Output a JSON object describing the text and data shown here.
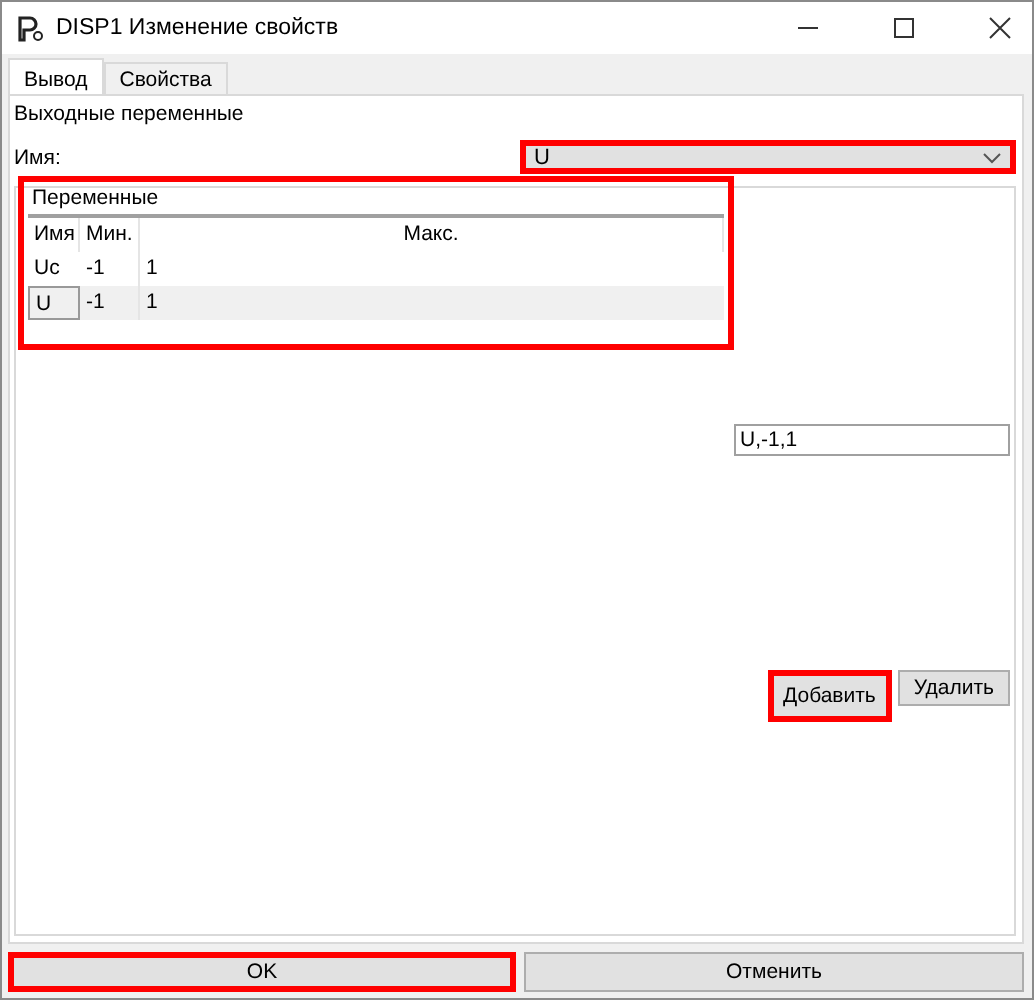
{
  "window": {
    "title": "DISP1 Изменение свойств"
  },
  "tabs": [
    {
      "label": "Вывод",
      "selected": true
    },
    {
      "label": "Свойства",
      "selected": false
    }
  ],
  "section_label": "Выходные переменные",
  "name_field": {
    "label": "Имя:",
    "value": "U",
    "highlighted": true
  },
  "variables": {
    "title": "Переменные",
    "highlighted": true,
    "columns": [
      "Имя",
      "Мин.",
      "Макс."
    ],
    "rows": [
      {
        "cells": [
          "Uc",
          "-1",
          "1"
        ],
        "selected": false
      },
      {
        "cells": [
          "U",
          "-1",
          "1"
        ],
        "selected": true
      }
    ]
  },
  "entry_field": {
    "value": "U,-1,1"
  },
  "buttons": [
    {
      "label": "Добавить",
      "highlighted": true
    },
    {
      "label": "Удалить",
      "highlighted": false
    }
  ],
  "footer_buttons": [
    {
      "label": "OK",
      "highlighted": true
    },
    {
      "label": "Отменить",
      "highlighted": false
    }
  ]
}
